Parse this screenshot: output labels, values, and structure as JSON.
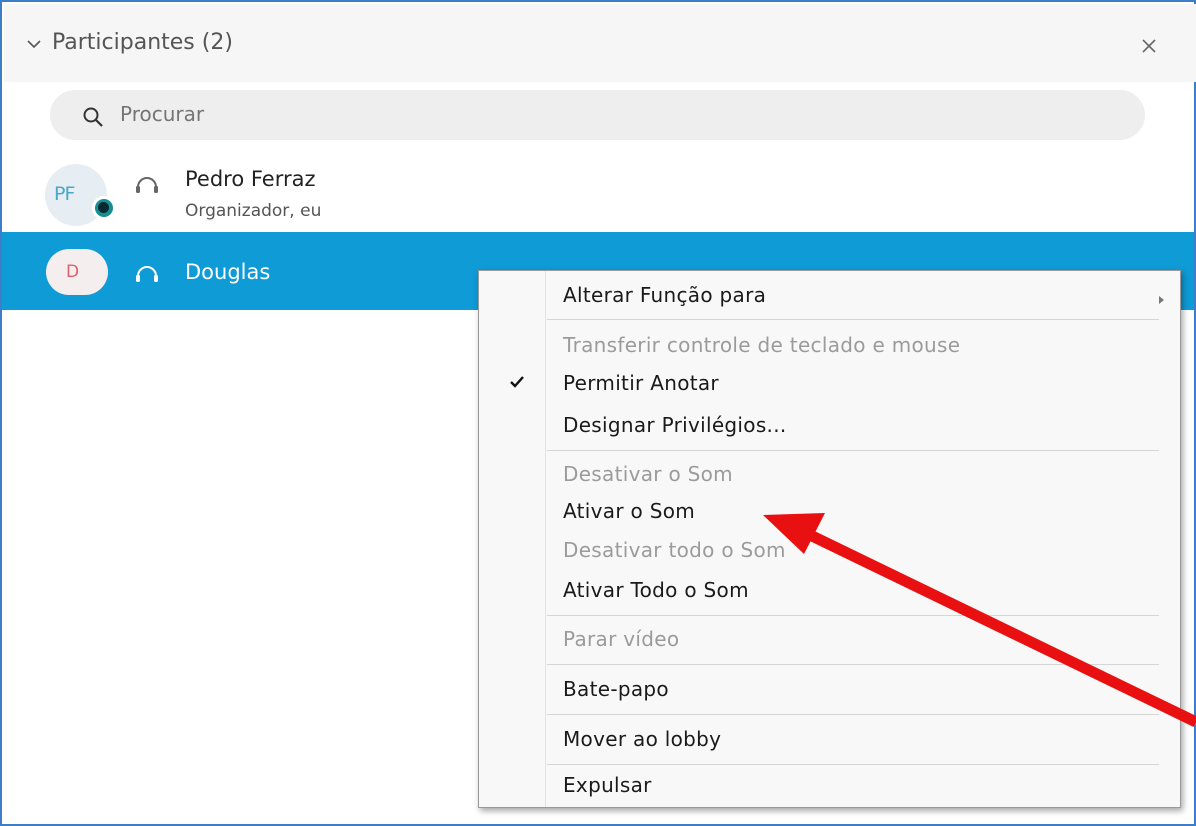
{
  "panel": {
    "title": "Participantes (2)"
  },
  "search": {
    "placeholder": "Procurar"
  },
  "participants": [
    {
      "initials": "PF",
      "name": "Pedro Ferraz",
      "role": "Organizador, eu"
    },
    {
      "initials": "D",
      "name": "Douglas"
    }
  ],
  "menu": {
    "items": [
      {
        "label": "Alterar Função para",
        "mnemonic": "F",
        "enabled": true,
        "submenu": true
      },
      {
        "label": "Transferir controle de teclado e mouse",
        "mnemonic": "t",
        "enabled": false
      },
      {
        "label": "Permitir Anotar",
        "mnemonic": "i",
        "enabled": true,
        "checked": true
      },
      {
        "label": "Designar Privilégios...",
        "mnemonic": "v",
        "enabled": true
      },
      {
        "label": "Desativar o Som",
        "mnemonic": "D",
        "enabled": false
      },
      {
        "label": "Ativar o Som",
        "mnemonic": "m",
        "enabled": true
      },
      {
        "label": "Desativar todo o Som",
        "mnemonic": "s",
        "enabled": false
      },
      {
        "label": "Ativar Todo o Som",
        "mnemonic": "r",
        "enabled": true
      },
      {
        "label": "Parar vídeo",
        "mnemonic": "P",
        "enabled": false
      },
      {
        "label": "Bate-papo",
        "mnemonic": "a",
        "enabled": true
      },
      {
        "label": "Mover ao lobby",
        "mnemonic": "l",
        "enabled": true
      },
      {
        "label": "Expulsar",
        "mnemonic": "p",
        "enabled": true
      }
    ]
  },
  "colors": {
    "selected_row": "#0f9bd6",
    "frame_border": "#3e7ec8",
    "annotation_arrow": "#e81010"
  },
  "icons": [
    "chevron-down-icon",
    "close-icon",
    "search-icon",
    "headset-icon",
    "checkmark-icon",
    "submenu-arrow-icon"
  ]
}
